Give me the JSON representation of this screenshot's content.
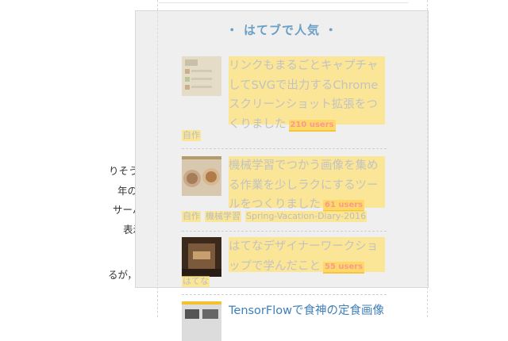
{
  "article": {
    "lines": [
      "りそう．いまはJSPで",
      "年の頃に触ったのが最",
      "サーバーからページを",
      "表示させた方がラクかも",
      "るが，地道に頑張って"
    ]
  },
  "widget": {
    "title": "・ はてブで人気 ・",
    "entries": [
      {
        "title": "リンクもまるごとキャプチャしてSVGで出力するChromeスクリーンショット拡張をつくりました",
        "users": "210 users",
        "tags": [
          "自作"
        ]
      },
      {
        "title": "機械学習でつかう画像を集める作業を少しラクにするツールをつくりました",
        "users": "61 users",
        "tags": [
          "自作",
          "機械学習",
          "Spring-Vacation-Diary-2016"
        ]
      },
      {
        "title": "はてなデザイナーワークショップで学んだこと",
        "users": "55 users",
        "tags": [
          "はてな"
        ]
      },
      {
        "title": "TensorFlowで食神の定食画像",
        "users": "",
        "tags": []
      }
    ]
  },
  "colors": {
    "title_blue": "#6a9fc6",
    "link_blue": "#3f7fb8",
    "highlight_yellow": "#ffe370",
    "users_red": "#f79b8e"
  }
}
